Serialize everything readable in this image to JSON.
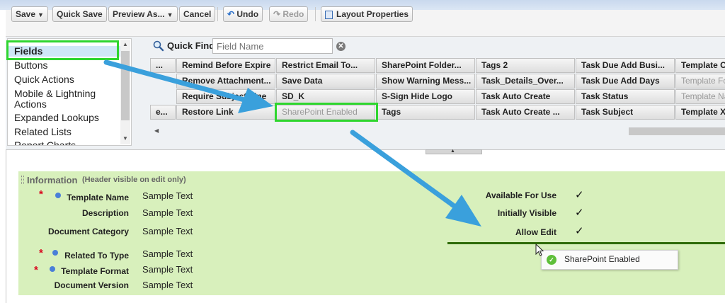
{
  "toolbar": {
    "save_label": "Save",
    "quick_save_label": "Quick Save",
    "preview_label": "Preview As...",
    "cancel_label": "Cancel",
    "undo_label": "Undo",
    "redo_label": "Redo",
    "layout_properties_label": "Layout Properties"
  },
  "categories": [
    "Fields",
    "Buttons",
    "Quick Actions",
    "Mobile & Lightning",
    "Actions",
    "Expanded Lookups",
    "Related Lists",
    "Report Charts"
  ],
  "quick_find": {
    "label": "Quick Find",
    "placeholder": "Field Name"
  },
  "field_grid": {
    "columns": [
      [
        "...",
        "",
        "",
        "e..."
      ],
      [
        "Remind Before Expire",
        "Remove Attachment...",
        "Require Subject Line",
        "Restore Link"
      ],
      [
        "Restrict Email To...",
        "Save Data",
        "SD_K",
        "SharePoint Enabled"
      ],
      [
        "SharePoint Folder...",
        "Show Warning Mess...",
        "S-Sign Hide Logo",
        "Tags"
      ],
      [
        "Tags 2",
        "Task_Details_Over...",
        "Task Auto Create",
        "Task Auto Create ..."
      ],
      [
        "Task Due Add Busi...",
        "Task Due Add Days",
        "Task Status",
        "Task Subject"
      ],
      [
        "Template C",
        "Template Fo",
        "Template Na",
        "Template XI"
      ]
    ]
  },
  "section": {
    "title": "Information",
    "subtitle": "(Header visible on edit only)",
    "left_fields": [
      {
        "label": "Template Name",
        "value": "Sample Text"
      },
      {
        "label": "Description",
        "value": "Sample Text"
      },
      {
        "label": "Document Category",
        "value": "Sample Text"
      },
      {
        "label": "Related To Type",
        "value": "Sample Text"
      },
      {
        "label": "Template Format",
        "value": "Sample Text"
      },
      {
        "label": "Document Version",
        "value": "Sample Text"
      }
    ],
    "right_fields": [
      {
        "label": "Available For Use",
        "value": "✓"
      },
      {
        "label": "Initially Visible",
        "value": "✓"
      },
      {
        "label": "Allow Edit",
        "value": "✓"
      }
    ]
  },
  "tooltip": {
    "text": "SharePoint Enabled"
  },
  "colors": {
    "highlight": "#2fd62f",
    "arrow": "#3aa0dc",
    "section_bg": "#d8f0bc",
    "dropline": "#2e6b06"
  }
}
